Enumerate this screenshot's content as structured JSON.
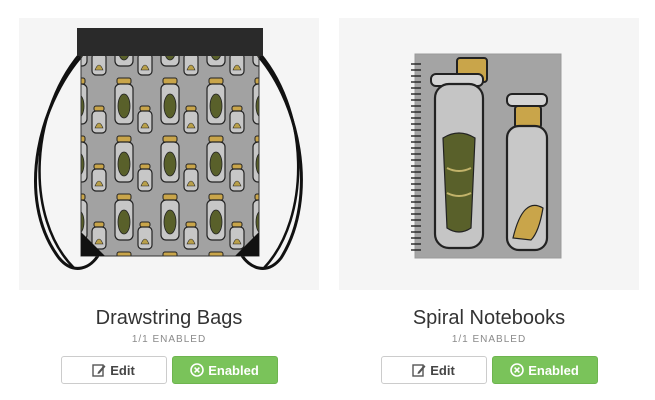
{
  "products": [
    {
      "title": "Drawstring Bags",
      "status": "1/1 ENABLED",
      "edit_label": "Edit",
      "enabled_label": "Enabled",
      "thumb_icon": "drawstring-bag-image"
    },
    {
      "title": "Spiral Notebooks",
      "status": "1/1 ENABLED",
      "edit_label": "Edit",
      "enabled_label": "Enabled",
      "thumb_icon": "spiral-notebook-image"
    }
  ],
  "colors": {
    "thumb_bg": "#f5f5f5",
    "enabled_green": "#7ac35a",
    "print_gray": "#a2a2a2",
    "cork": "#c9a54a",
    "moth_green": "#59602a"
  }
}
